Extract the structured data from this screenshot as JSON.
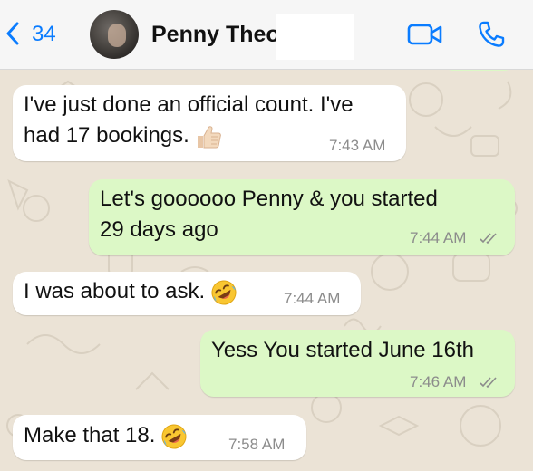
{
  "header": {
    "back_count": "34",
    "contact_name": "Penny Theo"
  },
  "icons": {
    "back": "chevron-left-icon",
    "avatar": "contact-avatar",
    "video": "video-call-icon",
    "phone": "voice-call-icon",
    "thumbs_up": "thumbs-up-emoji",
    "laugh": "rolling-on-floor-laughing-emoji",
    "read_receipt": "double-check-icon"
  },
  "colors": {
    "accent": "#0a7cff",
    "outgoing_bubble": "#dcf8c6",
    "incoming_bubble": "#ffffff",
    "wallpaper": "#ebe3d6"
  },
  "messages": [
    {
      "direction": "incoming",
      "lines": [
        "I've just done an official count. I've",
        "had 17 bookings."
      ],
      "emoji": "thumbs-up",
      "time": "7:43 AM"
    },
    {
      "direction": "outgoing",
      "lines": [
        "Let's goooooo Penny & you started",
        "29 days ago"
      ],
      "time": "7:44 AM",
      "status": "read"
    },
    {
      "direction": "incoming",
      "lines": [
        "I was about to ask."
      ],
      "emoji": "rolling-on-floor-laughing",
      "time": "7:44 AM"
    },
    {
      "direction": "outgoing",
      "lines": [
        "Yess You started June 16th"
      ],
      "time": "7:46 AM",
      "status": "read"
    },
    {
      "direction": "incoming",
      "lines": [
        "Make that 18."
      ],
      "emoji": "rolling-on-floor-laughing",
      "time": "7:58 AM"
    }
  ]
}
